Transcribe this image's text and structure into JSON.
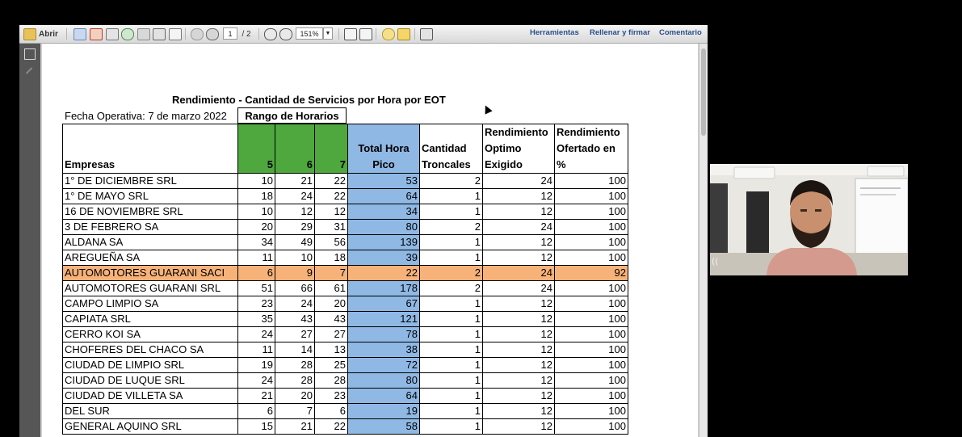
{
  "toolbar": {
    "open_label": "Abrir",
    "page_current": "1",
    "page_total": "/ 2",
    "zoom": "151%",
    "links": [
      "Herramientas",
      "Rellenar y firmar",
      "Comentario"
    ]
  },
  "document": {
    "title": "Rendimiento - Cantidad de Servicios por Hora por EOT",
    "fecha": "Fecha Operativa: 7 de marzo 2022",
    "rango": "Rango de Horarios",
    "headers": {
      "empresas": "Empresas",
      "h5": "5",
      "h6": "6",
      "h7": "7",
      "total_line1": "Total Hora",
      "total_line2": "Pico",
      "cant_line1": "Cantidad",
      "cant_line2": "Troncales",
      "opt_line1": "Rendimiento",
      "opt_line2": "Optimo",
      "opt_line3": "Exigido",
      "ofe_line1": "Rendimiento",
      "ofe_line2": "Ofertado en",
      "ofe_line3": "%"
    },
    "rows": [
      {
        "name": "1° DE DICIEMBRE SRL",
        "h5": "10",
        "h6": "21",
        "h7": "22",
        "total": "53",
        "cant": "2",
        "opt": "24",
        "ofe": "100"
      },
      {
        "name": "1° DE MAYO SRL",
        "h5": "18",
        "h6": "24",
        "h7": "22",
        "total": "64",
        "cant": "1",
        "opt": "12",
        "ofe": "100"
      },
      {
        "name": "16 DE NOVIEMBRE SRL",
        "h5": "10",
        "h6": "12",
        "h7": "12",
        "total": "34",
        "cant": "1",
        "opt": "12",
        "ofe": "100"
      },
      {
        "name": "3 DE FEBRERO SA",
        "h5": "20",
        "h6": "29",
        "h7": "31",
        "total": "80",
        "cant": "2",
        "opt": "24",
        "ofe": "100"
      },
      {
        "name": "ALDANA SA",
        "h5": "34",
        "h6": "49",
        "h7": "56",
        "total": "139",
        "cant": "1",
        "opt": "12",
        "ofe": "100"
      },
      {
        "name": "AREGUEÑA SA",
        "h5": "11",
        "h6": "10",
        "h7": "18",
        "total": "39",
        "cant": "1",
        "opt": "12",
        "ofe": "100"
      },
      {
        "name": "AUTOMOTORES GUARANI SACI",
        "h5": "6",
        "h6": "9",
        "h7": "7",
        "total": "22",
        "cant": "2",
        "opt": "24",
        "ofe": "92"
      },
      {
        "name": "AUTOMOTORES GUARANI SRL",
        "h5": "51",
        "h6": "66",
        "h7": "61",
        "total": "178",
        "cant": "2",
        "opt": "24",
        "ofe": "100"
      },
      {
        "name": "CAMPO LIMPIO SA",
        "h5": "23",
        "h6": "24",
        "h7": "20",
        "total": "67",
        "cant": "1",
        "opt": "12",
        "ofe": "100"
      },
      {
        "name": "CAPIATA SRL",
        "h5": "35",
        "h6": "43",
        "h7": "43",
        "total": "121",
        "cant": "1",
        "opt": "12",
        "ofe": "100"
      },
      {
        "name": "CERRO KOI SA",
        "h5": "24",
        "h6": "27",
        "h7": "27",
        "total": "78",
        "cant": "1",
        "opt": "12",
        "ofe": "100"
      },
      {
        "name": "CHOFERES DEL CHACO SA",
        "h5": "11",
        "h6": "14",
        "h7": "13",
        "total": "38",
        "cant": "1",
        "opt": "12",
        "ofe": "100"
      },
      {
        "name": "CIUDAD DE LIMPIO SRL",
        "h5": "19",
        "h6": "28",
        "h7": "25",
        "total": "72",
        "cant": "1",
        "opt": "12",
        "ofe": "100"
      },
      {
        "name": "CIUDAD DE LUQUE SRL",
        "h5": "24",
        "h6": "28",
        "h7": "28",
        "total": "80",
        "cant": "1",
        "opt": "12",
        "ofe": "100"
      },
      {
        "name": "CIUDAD DE VILLETA SA",
        "h5": "21",
        "h6": "20",
        "h7": "23",
        "total": "64",
        "cant": "1",
        "opt": "12",
        "ofe": "100"
      },
      {
        "name": "DEL SUR",
        "h5": "6",
        "h6": "7",
        "h7": "6",
        "total": "19",
        "cant": "1",
        "opt": "12",
        "ofe": "100"
      },
      {
        "name": "GENERAL AQUINO SRL",
        "h5": "15",
        "h6": "21",
        "h7": "22",
        "total": "58",
        "cant": "1",
        "opt": "12",
        "ofe": "100"
      }
    ]
  },
  "colors": {
    "hour_header": "#4ea83e",
    "total_column": "#8fb8e4",
    "highlight_row": "#f7b27a",
    "toolbar_link": "#2a4f8c"
  }
}
